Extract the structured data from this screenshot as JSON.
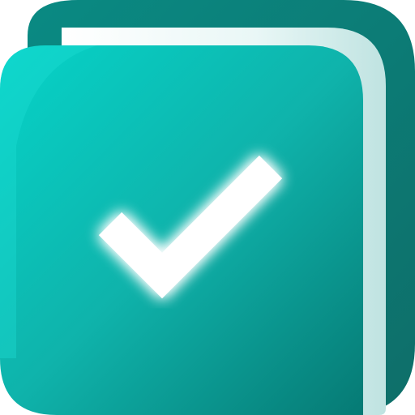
{
  "icon": {
    "name": "checklist-notebook-app-icon",
    "glyph": "checkmark-icon",
    "colors": {
      "background": "#ffffff",
      "cover_light": "#06d3c8",
      "cover_mid": "#0fb3ab",
      "cover_dark": "#067a74",
      "spine": "#0e6e69",
      "pages_light": "#ffffff",
      "pages_shade": "#c8e9e8",
      "check": "#ffffff",
      "check_glow": "#8ff7f0"
    }
  }
}
